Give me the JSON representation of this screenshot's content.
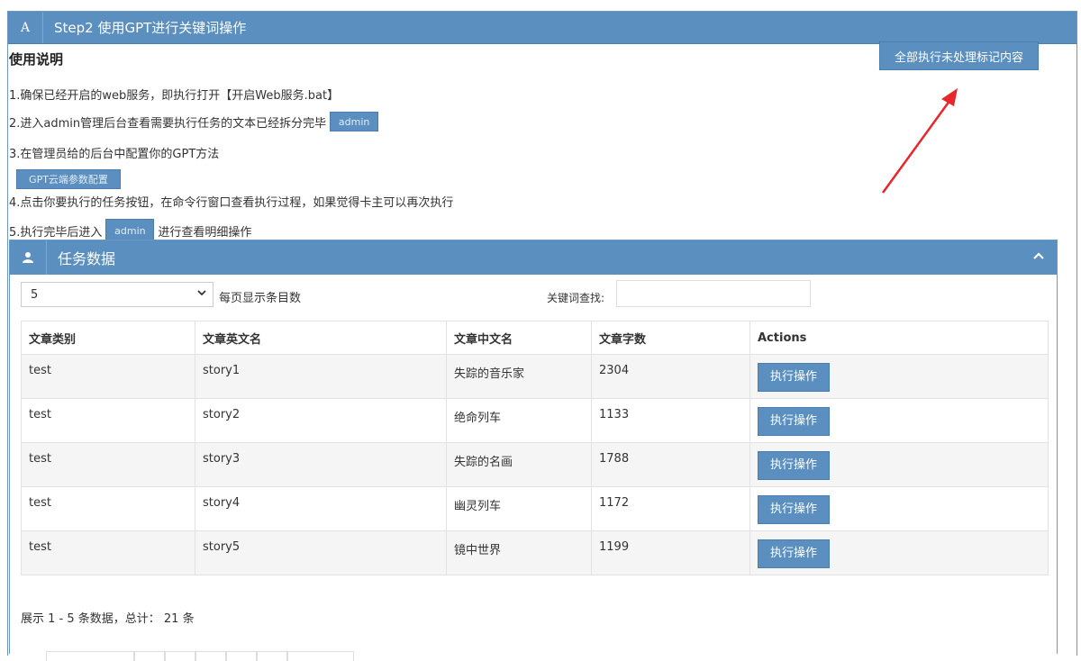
{
  "header": {
    "icon_letter": "A",
    "title": "Step2 使用GPT进行关键词操作"
  },
  "instructions": {
    "title": "使用说明",
    "line1": "1.确保已经开启的web服务，即执行打开【开启Web服务.bat】",
    "line2": "2.进入admin管理后台查看需要执行任务的文本已经拆分完毕",
    "line2_button": "admin",
    "line3": "3.在管理员给的后台中配置你的GPT方法",
    "line3_button": "GPT云端参数配置",
    "line4": "4.点击你要执行的任务按钮，在命令行窗口查看执行过程，如果觉得卡主可以再次执行",
    "line5_pre": "5.执行完毕后进入",
    "line5_button": "admin",
    "line5_post": "进行查看明细操作"
  },
  "exec_all_button": "全部执行未处理标记内容",
  "colors": {
    "primary": "#5b8fbf",
    "arrow": "#e8262b"
  },
  "panel": {
    "title": "任务数据",
    "icon": "user-icon",
    "page_size": "5",
    "page_size_label": "每页显示条目数",
    "search_label": "关键词查找:",
    "search_value": ""
  },
  "table": {
    "headers": [
      "文章类别",
      "文章英文名",
      "文章中文名",
      "文章字数",
      "Actions"
    ],
    "rows": [
      {
        "category": "test",
        "en_name": "story1",
        "cn_name": "失踪的音乐家",
        "words": "2304",
        "action": "执行操作"
      },
      {
        "category": "test",
        "en_name": "story2",
        "cn_name": "绝命列车",
        "words": "1133",
        "action": "执行操作"
      },
      {
        "category": "test",
        "en_name": "story3",
        "cn_name": "失踪的名画",
        "words": "1788",
        "action": "执行操作"
      },
      {
        "category": "test",
        "en_name": "story4",
        "cn_name": "幽灵列车",
        "words": "1172",
        "action": "执行操作"
      },
      {
        "category": "test",
        "en_name": "story5",
        "cn_name": "镜中世界",
        "words": "1199",
        "action": "执行操作"
      }
    ]
  },
  "summary": "展示 1 - 5 条数据，总计： 21 条"
}
